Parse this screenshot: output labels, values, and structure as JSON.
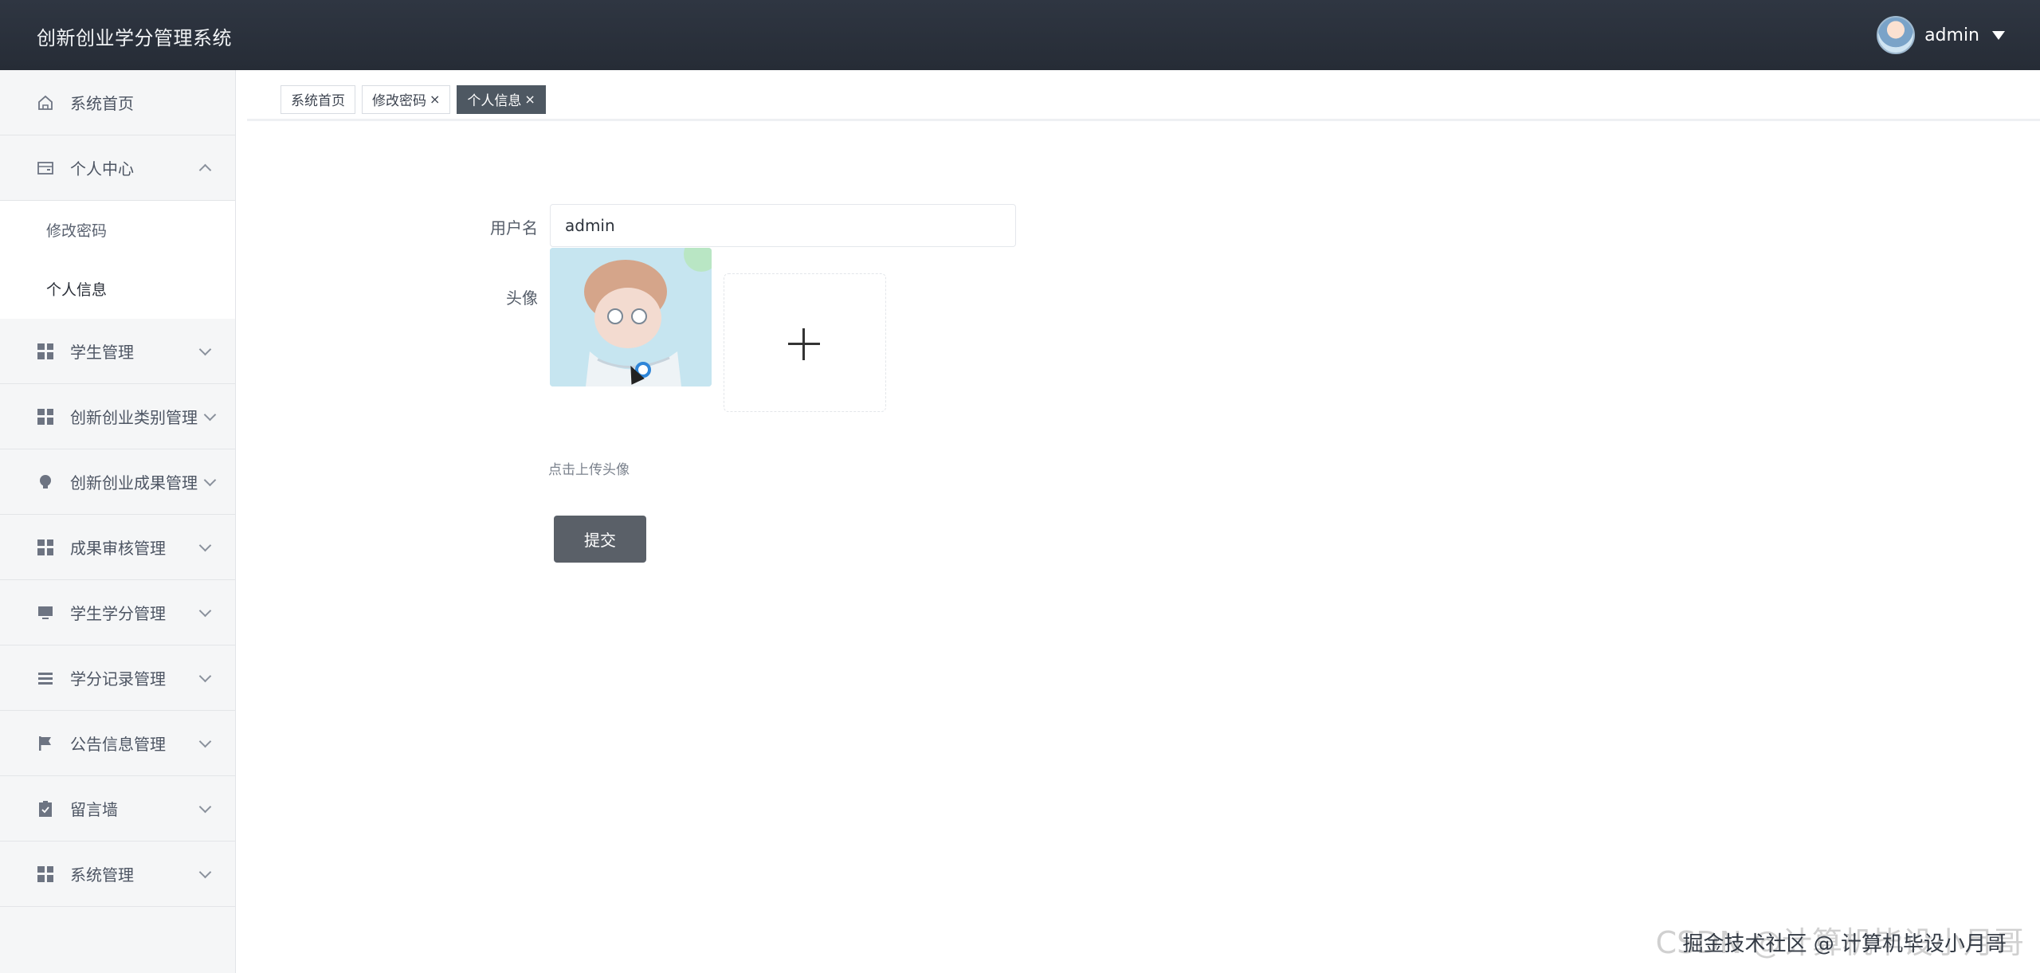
{
  "app": {
    "title": "创新创业学分管理系统"
  },
  "user": {
    "name": "admin"
  },
  "sidebar": {
    "items": [
      {
        "label": "系统首页",
        "icon": "home-icon",
        "chevron": "none"
      },
      {
        "label": "个人中心",
        "icon": "wallet-icon",
        "chevron": "up",
        "children": [
          {
            "label": "修改密码"
          },
          {
            "label": "个人信息"
          }
        ]
      },
      {
        "label": "学生管理",
        "icon": "grid-icon",
        "chevron": "down"
      },
      {
        "label": "创新创业类别管理",
        "icon": "grid-icon",
        "chevron": "down"
      },
      {
        "label": "创新创业成果管理",
        "icon": "bulb-icon",
        "chevron": "down"
      },
      {
        "label": "成果审核管理",
        "icon": "grid-icon",
        "chevron": "down"
      },
      {
        "label": "学生学分管理",
        "icon": "monitor-icon",
        "chevron": "down"
      },
      {
        "label": "学分记录管理",
        "icon": "list-icon",
        "chevron": "down"
      },
      {
        "label": "公告信息管理",
        "icon": "flag-icon",
        "chevron": "down"
      },
      {
        "label": "留言墙",
        "icon": "clipboard-icon",
        "chevron": "down"
      },
      {
        "label": "系统管理",
        "icon": "grid-icon",
        "chevron": "down"
      }
    ]
  },
  "tabs": [
    {
      "label": "系统首页",
      "closable": false,
      "active": false
    },
    {
      "label": "修改密码",
      "closable": true,
      "active": false
    },
    {
      "label": "个人信息",
      "closable": true,
      "active": true
    }
  ],
  "tab_close_glyph": "×",
  "form": {
    "username_label": "用户名",
    "username_value": "admin",
    "avatar_label": "头像",
    "upload_hint": "点击上传头像",
    "submit_label": "提交"
  },
  "watermark": {
    "text_front": "掘金技术社区 @ 计算机毕设小月哥",
    "text_back": "CSDN @计算机毕设小月哥"
  },
  "colors": {
    "header_bg": "#2b313b",
    "sidebar_bg": "#f5f6f7",
    "active_tab_bg": "#4e5862",
    "submit_bg": "#5a6068"
  }
}
